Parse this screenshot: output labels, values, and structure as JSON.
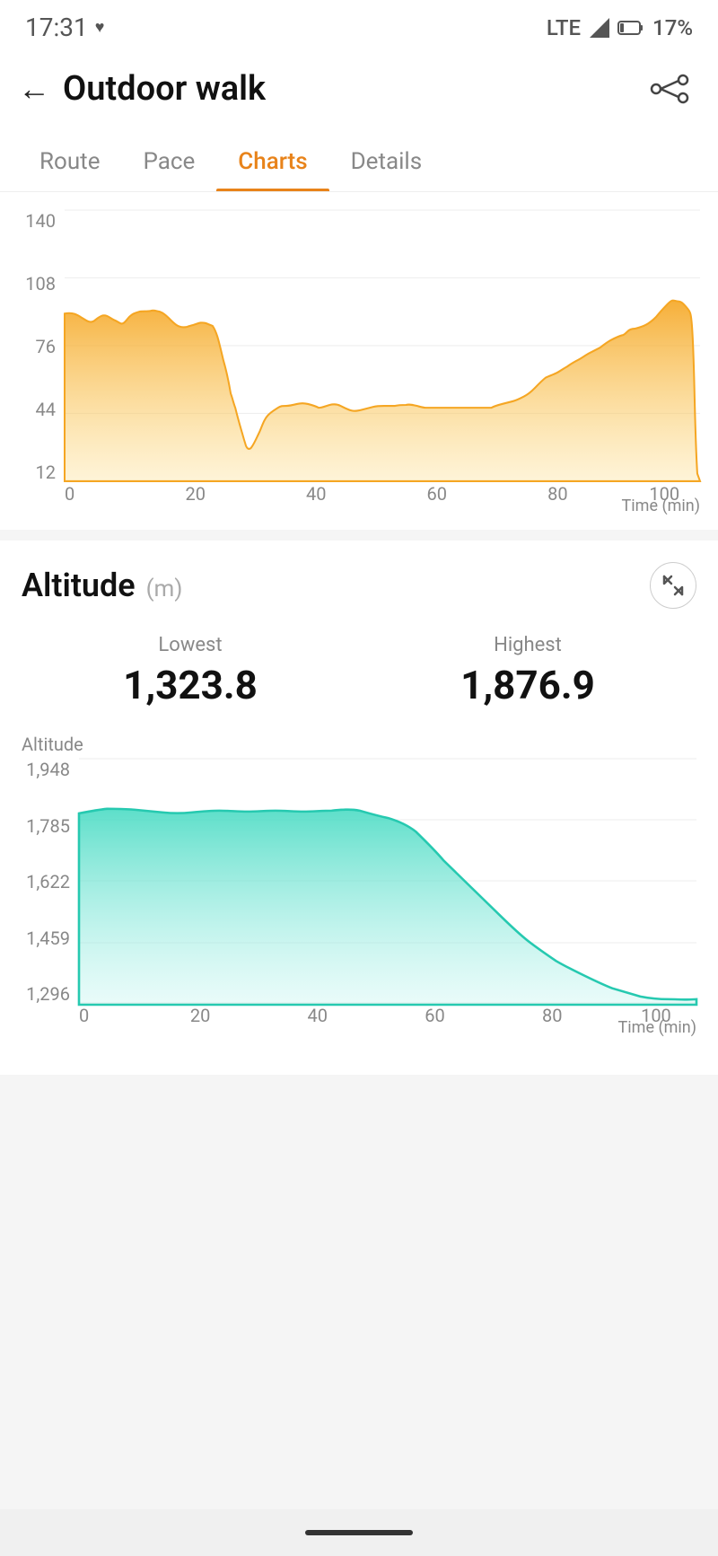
{
  "statusBar": {
    "time": "17:31",
    "signal": "LTE",
    "battery": "17%"
  },
  "header": {
    "title": "Outdoor walk",
    "backLabel": "←",
    "shareLabel": "share"
  },
  "tabs": [
    {
      "id": "route",
      "label": "Route",
      "active": false
    },
    {
      "id": "pace",
      "label": "Pace",
      "active": false
    },
    {
      "id": "charts",
      "label": "Charts",
      "active": true
    },
    {
      "id": "details",
      "label": "Details",
      "active": false
    }
  ],
  "heartRateChart": {
    "yLabels": [
      "140",
      "108",
      "76",
      "44",
      "12"
    ],
    "xLabels": [
      "0",
      "20",
      "40",
      "60",
      "80",
      "100"
    ],
    "xUnit": "Time (min)"
  },
  "altitudeSection": {
    "title": "Altitude",
    "unit": "(m)",
    "lowest": {
      "label": "Lowest",
      "value": "1,323.8"
    },
    "highest": {
      "label": "Highest",
      "value": "1,876.9"
    },
    "yAxisTitle": "Altitude",
    "yLabels": [
      "1,948",
      "1,785",
      "1,622",
      "1,459",
      "1,296"
    ],
    "xLabels": [
      "0",
      "20",
      "40",
      "60",
      "80",
      "100"
    ],
    "xUnit": "Time (min)"
  }
}
